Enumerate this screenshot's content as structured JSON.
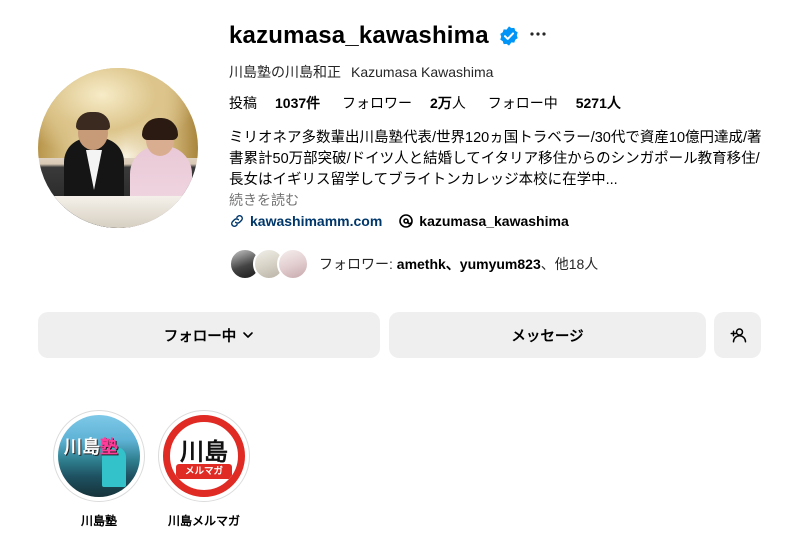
{
  "profile": {
    "username": "kazumasa_kawashima",
    "verified": true,
    "display_name_jp": "川島塾の川島和正",
    "display_name_en": "Kazumasa Kawashima"
  },
  "stats": {
    "posts_label": "投稿",
    "posts_value": "1037件",
    "followers_label": "フォロワー",
    "followers_value": "2万",
    "followers_suffix": "人",
    "following_label": "フォロー中",
    "following_value": "5271人"
  },
  "bio": {
    "text": "ミリオネア多数輩出川島塾代表/世界120ヵ国トラベラー/30代で資産10億円達成/著書累計50万部突破/ドイツ人と結婚してイタリア移住からのシンガポール教育移住/長女はイギリス留学してブライトンカレッジ本校に在学中...",
    "read_more": "続きを読む"
  },
  "links": {
    "website": "kawashimamm.com",
    "threads": "kazumasa_kawashima"
  },
  "followed_by": {
    "prefix": "フォロワー: ",
    "names": "amethk、yumyum823",
    "suffix": "、他18人"
  },
  "buttons": {
    "following": "フォロー中",
    "message": "メッセージ"
  },
  "highlights": [
    {
      "label": "川島塾",
      "cover_text_a": "川島",
      "cover_text_b": "塾"
    },
    {
      "label": "川島メルマガ",
      "cover_text": "川島",
      "cover_tag": "メルマガ"
    }
  ],
  "colors": {
    "verified_blue": "#0095f6",
    "link_blue": "#00376b",
    "button_bg": "#efefef",
    "highlight_red": "#e02a24"
  }
}
